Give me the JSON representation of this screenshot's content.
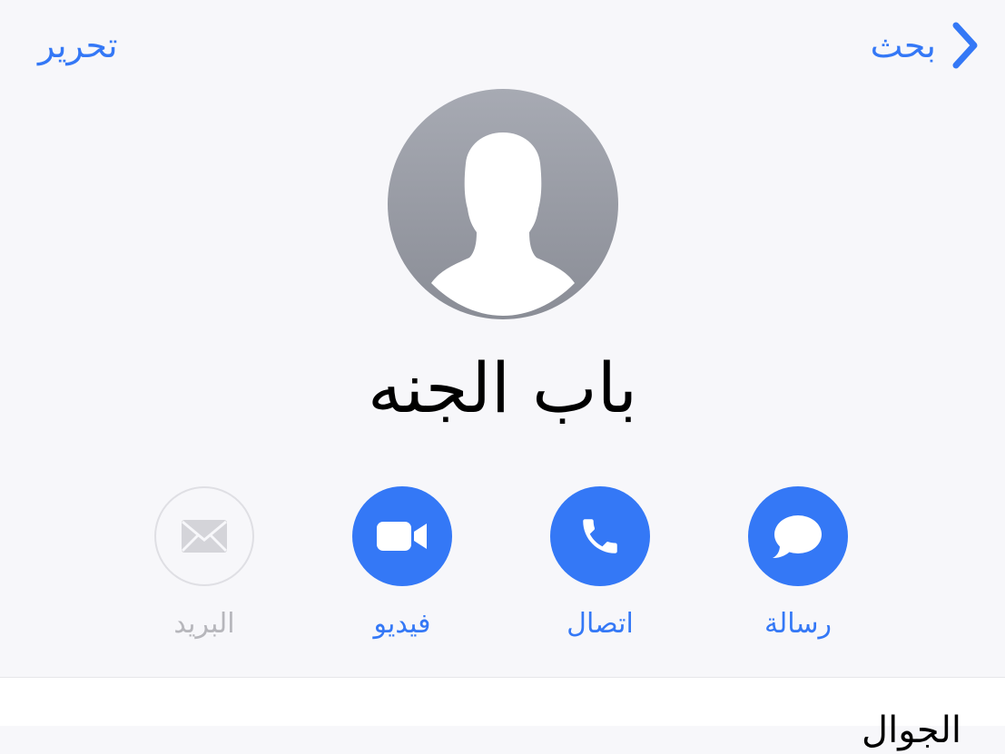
{
  "nav": {
    "back_label": "بحث",
    "edit_label": "تحرير"
  },
  "contact": {
    "name": "باب الجنه"
  },
  "actions": [
    {
      "label": "رسالة",
      "icon": "message-bubble-icon",
      "enabled": true
    },
    {
      "label": "اتصال",
      "icon": "phone-icon",
      "enabled": true
    },
    {
      "label": "فيديو",
      "icon": "video-camera-icon",
      "enabled": true
    },
    {
      "label": "البريد",
      "icon": "mail-envelope-icon",
      "enabled": false
    }
  ],
  "sheet": {
    "section_label": "الجوال"
  },
  "colors": {
    "accent": "#3478f6",
    "background": "#f7f7fa",
    "disabled": "#b6b6bb"
  }
}
